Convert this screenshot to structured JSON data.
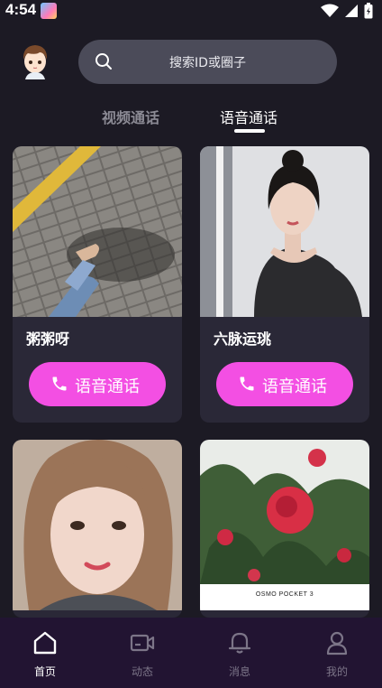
{
  "status_bar": {
    "time": "4:54"
  },
  "search": {
    "placeholder": "搜索ID或圈子"
  },
  "tabs": [
    {
      "label": "视频通话",
      "active": false
    },
    {
      "label": "语音通话",
      "active": true
    }
  ],
  "cards": [
    {
      "name": "粥粥呀",
      "button_label": "语音通话"
    },
    {
      "name": "六脉运珧",
      "button_label": "语音通话"
    },
    {
      "name": "",
      "button_label": ""
    },
    {
      "name": "",
      "button_label": "",
      "photo_caption": "OSMO POCKET 3"
    }
  ],
  "nav": [
    {
      "label": "首页",
      "icon": "home-icon",
      "active": true
    },
    {
      "label": "动态",
      "icon": "video-camera-icon",
      "active": false
    },
    {
      "label": "消息",
      "icon": "bell-icon",
      "active": false
    },
    {
      "label": "我的",
      "icon": "person-icon",
      "active": false
    }
  ],
  "colors": {
    "background": "#1c1a24",
    "card": "#2a2837",
    "accent": "#f34fe3",
    "navbar": "#221432"
  }
}
